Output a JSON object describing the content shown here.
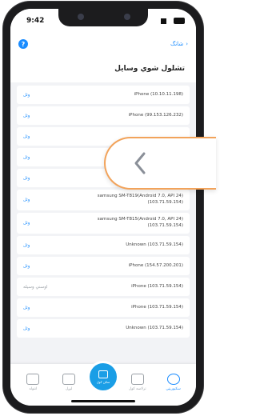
{
  "status": {
    "time": "9:42"
  },
  "nav": {
    "back_label": "شانگ",
    "help_symbol": "?"
  },
  "page": {
    "title": "تشلول شوي وسايل"
  },
  "devices": [
    {
      "name": "iPhone (10.10.11.198)",
      "action": "وتل",
      "muted": false,
      "tall": false
    },
    {
      "name": "iPhone (99.153.126.232)",
      "action": "وتل",
      "muted": false,
      "tall": false
    },
    {
      "name": "",
      "action": "وتل",
      "muted": false,
      "tall": false
    },
    {
      "name": "",
      "action": "وتل",
      "muted": false,
      "tall": false
    },
    {
      "name": "",
      "action": "وتل",
      "muted": false,
      "tall": false
    },
    {
      "name": "samsung SM-T819(Android 7.0, API 24)\n(103.71.59.154)",
      "action": "وتل",
      "muted": false,
      "tall": true
    },
    {
      "name": "samsung SM-T815(Android 7.0, API 24)\n(103.71.59.154)",
      "action": "وتل",
      "muted": false,
      "tall": true
    },
    {
      "name": "Unknown (103.71.59.154)",
      "action": "وتل",
      "muted": false,
      "tall": false
    },
    {
      "name": "iPhone (154.57.200.201)",
      "action": "وتل",
      "muted": false,
      "tall": false
    },
    {
      "name": "iPhone (103.71.59.154)",
      "action": "اوسني وسيله",
      "muted": true,
      "tall": false
    },
    {
      "name": "iPhone (103.71.59.154)",
      "action": "وتل",
      "muted": false,
      "tall": false
    },
    {
      "name": "Unknown (103.71.59.154)",
      "action": "وتل",
      "muted": false,
      "tall": false
    }
  ],
  "tabs": [
    {
      "label": "انتولد",
      "icon": "wallet-icon"
    },
    {
      "label": "ليږل",
      "icon": "upload-icon"
    },
    {
      "label": "سکن کول",
      "icon": "scan-icon",
      "center": true
    },
    {
      "label": "ترلاسه کول",
      "icon": "download-icon"
    },
    {
      "label": "سکیوریټي",
      "icon": "play-circle-icon",
      "active": true
    }
  ],
  "colors": {
    "accent": "#1a8cff",
    "overlay_border": "#f2a35b"
  }
}
